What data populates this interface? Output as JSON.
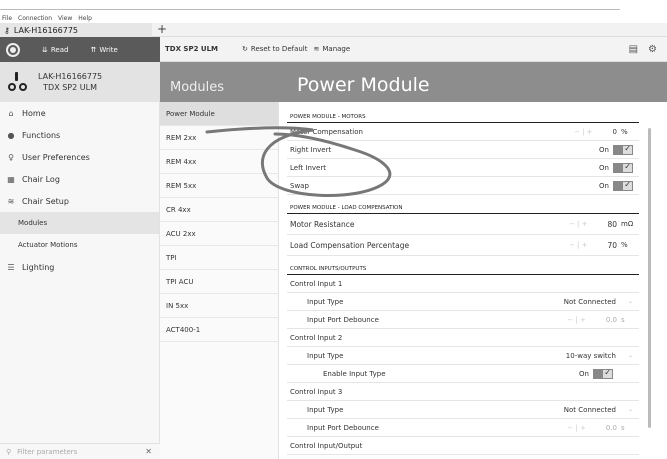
{
  "menu": [
    "File",
    "Connection",
    "View",
    "Help"
  ],
  "tab": {
    "label": "LAK-H16166775",
    "add": "+"
  },
  "toolbar_left": {
    "read": "Read",
    "write": "Write"
  },
  "toolbar": {
    "device": "TDX SP2 ULM",
    "reset": "Reset to Default",
    "manage": "Manage"
  },
  "device": {
    "id": "LAK-H16166775",
    "model": "TDX SP2 ULM"
  },
  "nav": [
    {
      "label": "Home",
      "icon": "home-icon"
    },
    {
      "label": "Functions",
      "icon": "functions-icon"
    },
    {
      "label": "User Preferences",
      "icon": "user-icon"
    },
    {
      "label": "Chair Log",
      "icon": "log-icon"
    },
    {
      "label": "Chair Setup",
      "icon": "setup-icon"
    }
  ],
  "subnav": [
    "Modules",
    "Actuator Motions"
  ],
  "nav_lighting": "Lighting",
  "search_placeholder": "Filter parameters",
  "modules_header": "Modules",
  "modules": [
    "Power Module",
    "REM 2xx",
    "REM 4xx",
    "REM 5xx",
    "CR 4xx",
    "ACU 2xx",
    "TPI",
    "TPI ACU",
    "IN 5xx",
    "ACT400-1"
  ],
  "content_title": "Power Module",
  "sections": {
    "motors": "POWER MODULE - MOTORS",
    "load": "POWER MODULE - LOAD COMPENSATION",
    "io": "CONTROL INPUTS/OUTPUTS"
  },
  "motors": [
    {
      "label": "Motor Compensation",
      "value": "0",
      "unit": "%"
    },
    {
      "label": "Right Invert",
      "value": "On"
    },
    {
      "label": "Left Invert",
      "value": "On"
    },
    {
      "label": "Swap",
      "value": "On"
    }
  ],
  "load": [
    {
      "label": "Motor Resistance",
      "value": "80",
      "unit": "mΩ"
    },
    {
      "label": "Load Compensation Percentage",
      "value": "70",
      "unit": "%"
    }
  ],
  "io": {
    "ci1": "Control Input 1",
    "ci1_type_label": "Input Type",
    "ci1_type_value": "Not Connected",
    "ci1_deb_label": "Input Port Debounce",
    "ci1_deb_value": "0.0",
    "ci1_deb_unit": "s",
    "ci2": "Control Input 2",
    "ci2_type_label": "Input Type",
    "ci2_type_value": "10-way switch",
    "ci2_enable_label": "Enable Input Type",
    "ci2_enable_value": "On",
    "ci3": "Control Input 3",
    "ci3_type_label": "Input Type",
    "ci3_type_value": "Not Connected",
    "ci3_deb_label": "Input Port Debounce",
    "ci3_deb_value": "0.0",
    "ci3_deb_unit": "s",
    "cio": "Control Input/Output"
  }
}
